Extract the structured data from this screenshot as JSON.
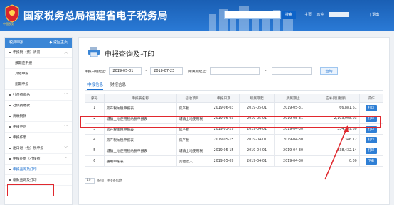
{
  "header": {
    "site_title": "国家税务总局福建省电子税务局",
    "logo_subtitle": "中国税务",
    "search_label": "搜索",
    "links": [
      "主页",
      "欢迎"
    ],
    "exit_label": "| 退出"
  },
  "sidebar": {
    "header_label": "税费申报",
    "back_label": "返回主页",
    "items": [
      {
        "label": "申报税（费）清册",
        "type": "top",
        "chevron": "up"
      },
      {
        "label": "按期应申报",
        "type": "sub"
      },
      {
        "label": "其他申报",
        "type": "sub"
      },
      {
        "label": "逾期申报",
        "type": "sub"
      },
      {
        "label": "社保费缴纳",
        "type": "top",
        "chevron": "down"
      },
      {
        "label": "社保费缴款",
        "type": "top",
        "chevron": ""
      },
      {
        "label": "清缴税款",
        "type": "top",
        "chevron": ""
      },
      {
        "label": "申报更正",
        "type": "top",
        "chevron": "down"
      },
      {
        "label": "申报作废",
        "type": "top",
        "chevron": ""
      },
      {
        "label": "出口退（免）税申报",
        "type": "top",
        "chevron": "down"
      },
      {
        "label": "申报补偿（社保费）",
        "type": "top",
        "chevron": "down"
      },
      {
        "label": "申报查询及打印",
        "type": "top",
        "chevron": "",
        "active": true
      },
      {
        "label": "缴款查询及打印",
        "type": "top",
        "chevron": ""
      }
    ]
  },
  "main": {
    "page_title": "申报查询及打印",
    "filter": {
      "start_label": "申报日期起止:",
      "start_date": "2019-05-01",
      "sep": "-",
      "end_date": "2019-07-23",
      "period_label": "所属期起止:",
      "period_start": "",
      "period_end": "",
      "query_button": "查询"
    },
    "tabs": [
      "申报信息",
      "财报信息"
    ],
    "table": {
      "headers": [
        "序号",
        "申报表名称",
        "征收项目",
        "申报日期",
        "所属期起",
        "所属期止",
        "应补(退)税额",
        "操作"
      ],
      "rows": [
        {
          "no": "1",
          "name": "房产税纳税申报表",
          "item": "房产税",
          "date": "2019-06-03",
          "start": "2019-05-01",
          "end": "2019-05-31",
          "amount": "66,881.61",
          "action": "打印"
        },
        {
          "no": "2",
          "name": "城镇土地使用税纳税申报表",
          "item": "城镇土地使用税",
          "date": "2019-06-03",
          "start": "2019-05-01",
          "end": "2019-05-31",
          "amount": "2,193,908.03",
          "action": "打印"
        },
        {
          "no": "3",
          "name": "房产税纳税申报表",
          "item": "房产税",
          "date": "2019-05-29",
          "start": "2019-04-01",
          "end": "2019-04-30",
          "amount": "354,589.60",
          "action": "打印"
        },
        {
          "no": "4",
          "name": "房产税纳税申报表",
          "item": "房产税",
          "date": "2019-05-15",
          "start": "2019-04-01",
          "end": "2019-04-30",
          "amount": "346.12",
          "action": "打印"
        },
        {
          "no": "5",
          "name": "城镇土地使用税纳税申报表",
          "item": "城镇土地使用税",
          "date": "2019-05-15",
          "start": "2019-04-01",
          "end": "2019-04-30",
          "amount": "338,432.14",
          "action": "打印"
        },
        {
          "no": "6",
          "name": "通用申报表",
          "item": "其他收入",
          "date": "2019-05-09",
          "start": "2019-04-01",
          "end": "2019-04-30",
          "amount": "0.00",
          "action": "下载"
        }
      ]
    },
    "pager": {
      "page_size": "10",
      "text": "条/页，共6条信息"
    }
  },
  "colors": {
    "header_blue": "#1a5fb4",
    "accent": "#1a6fd0",
    "highlight_red": "#e0282e",
    "button_blue": "#2f7fd5"
  },
  "icons": [
    "emblem-icon",
    "printer-icon",
    "chevron-up-icon",
    "chevron-down-icon",
    "arrow-annotation"
  ]
}
